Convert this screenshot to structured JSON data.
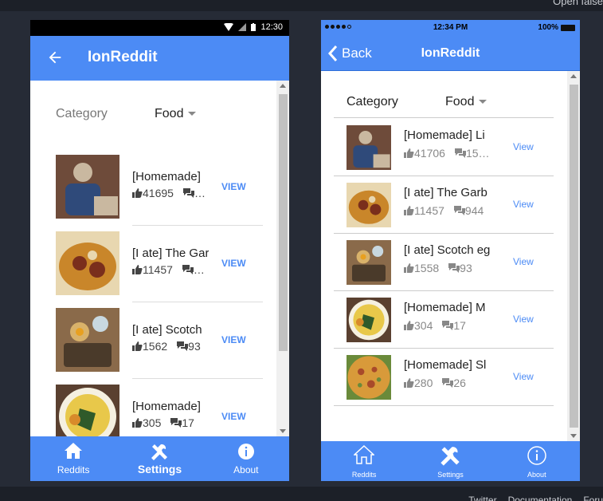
{
  "page_header": {
    "right_text": "Open false"
  },
  "footer": {
    "links": [
      "Twitter",
      "Documentation",
      "Foru"
    ]
  },
  "android": {
    "status": {
      "time": "12:30"
    },
    "header": {
      "title": "IonReddit"
    },
    "category": {
      "label": "Category",
      "value": "Food"
    },
    "items": [
      {
        "title": "[Homemade]",
        "upvotes": "41695",
        "comments": "…",
        "action": "VIEW",
        "thumb_colors": [
          "#6e4b3a",
          "#2f4a7a",
          "#c9b8a0"
        ]
      },
      {
        "title": "[I ate] The Gar",
        "upvotes": "11457",
        "comments": "…",
        "action": "VIEW",
        "thumb_colors": [
          "#c9862a",
          "#7a2e1c",
          "#e8d7b0"
        ]
      },
      {
        "title": "[I ate] Scotch",
        "upvotes": "1562",
        "comments": "93",
        "action": "VIEW",
        "thumb_colors": [
          "#8a6a4a",
          "#d9b26a",
          "#4a3a2a"
        ]
      },
      {
        "title": "[Homemade]",
        "upvotes": "305",
        "comments": "17",
        "action": "VIEW",
        "thumb_colors": [
          "#e8c84a",
          "#2f5a2a",
          "#f5f0e0"
        ]
      }
    ],
    "tabs": [
      {
        "label": "Reddits",
        "icon": "home-icon"
      },
      {
        "label": "Settings",
        "icon": "tools-icon"
      },
      {
        "label": "About",
        "icon": "info-icon"
      }
    ]
  },
  "ios": {
    "status": {
      "time": "12:34 PM",
      "battery": "100%"
    },
    "header": {
      "back_label": "Back",
      "title": "IonReddit"
    },
    "category": {
      "label": "Category",
      "value": "Food"
    },
    "items": [
      {
        "title": "[Homemade] Li",
        "upvotes": "41706",
        "comments": "15…",
        "action": "View",
        "thumb_colors": [
          "#6e4b3a",
          "#2f4a7a",
          "#c9b8a0"
        ]
      },
      {
        "title": "[I ate] The Garb",
        "upvotes": "11457",
        "comments": "944",
        "action": "View",
        "thumb_colors": [
          "#c9862a",
          "#7a2e1c",
          "#e8d7b0"
        ]
      },
      {
        "title": "[I ate] Scotch eg",
        "upvotes": "1558",
        "comments": "93",
        "action": "View",
        "thumb_colors": [
          "#8a6a4a",
          "#d9b26a",
          "#4a3a2a"
        ]
      },
      {
        "title": "[Homemade] M",
        "upvotes": "304",
        "comments": "17",
        "action": "View",
        "thumb_colors": [
          "#e8c84a",
          "#2f5a2a",
          "#f5f0e0"
        ]
      },
      {
        "title": "[Homemade] Sl",
        "upvotes": "280",
        "comments": "26",
        "action": "View",
        "thumb_colors": [
          "#d89a3a",
          "#a84a2a",
          "#6a8a3a"
        ]
      }
    ],
    "tabs": [
      {
        "label": "Reddits",
        "icon": "home-outline-icon"
      },
      {
        "label": "Settings",
        "icon": "tools-icon"
      },
      {
        "label": "About",
        "icon": "info-icon"
      }
    ]
  }
}
